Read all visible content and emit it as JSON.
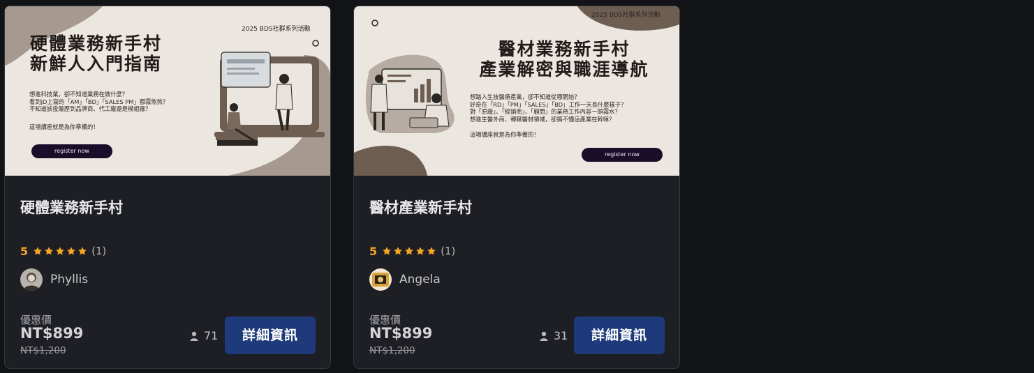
{
  "courses": [
    {
      "banner": {
        "tag": "2025 BDS社群系列活動",
        "title_lines": [
          "硬體業務新手村",
          "新鮮人入門指南"
        ],
        "desc_lines": [
          "想進科技業，卻不知道業務在做什麼？",
          "看到JD上寫的「AM」「BD」「SALES PM」都霧煞煞？",
          "不知道該投履歷到品牌商、代工廠還是模組廠？"
        ],
        "prompt": "這場講座就是為你準備的！",
        "register_label": "register now"
      },
      "title": "硬體業務新手村",
      "rating_score": "5",
      "rating_count": "(1)",
      "author": "Phyllis",
      "price_label": "優惠價",
      "price": "NT$899",
      "original_price": "NT$1,200",
      "enrolled": "71",
      "detail_label": "詳細資訊"
    },
    {
      "banner": {
        "tag": "2025 BDS社群系列活動",
        "title_lines": [
          "醫材業務新手村",
          "產業解密與職涯導航"
        ],
        "desc_lines": [
          "想踏入生技醫療產業，卻不知道從哪開始？",
          "好奇在「RD」「PM」「SALES」「BD」工作一天長什麼樣子？",
          "對「原廠」、「經銷商」、「顧問」的業務工作內容一頭霧水？",
          "想進生醫外商、轉職醫材領域，卻搞不懂這產業在幹嘛？"
        ],
        "prompt": "這場講座就是為你準備的！",
        "register_label": "register now"
      },
      "title": "醫材產業新手村",
      "rating_score": "5",
      "rating_count": "(1)",
      "author": "Angela",
      "price_label": "優惠價",
      "price": "NT$899",
      "original_price": "NT$1,200",
      "enrolled": "31",
      "detail_label": "詳細資訊"
    }
  ],
  "colors": {
    "star": "#f5a623",
    "button": "#1f3a7a",
    "card_bg": "#1d1f24",
    "page_bg": "#121316",
    "banner_bg": "#ece6e1",
    "banner_accent": "#6e5e52"
  },
  "icons": [
    "star-icon",
    "person-icon",
    "avatar-image"
  ]
}
